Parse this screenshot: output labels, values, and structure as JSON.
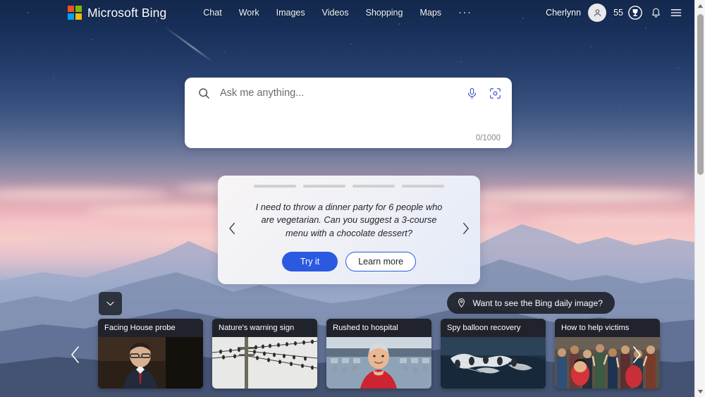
{
  "colors": {
    "ms_red": "#f25022",
    "ms_green": "#7fba00",
    "ms_blue": "#00a4ef",
    "ms_yellow": "#ffb900",
    "accent_blue": "#2b59e0",
    "progress_active": "#2b3a9e",
    "progress_inactive": "#cfcfcf",
    "card_dark": "#20232b",
    "scrollbar_thumb": "#a8a8a8"
  },
  "header": {
    "brand": "Microsoft Bing",
    "logo_icon": "microsoft-logo-icon",
    "nav": [
      {
        "label": "Chat",
        "name": "nav-chat"
      },
      {
        "label": "Work",
        "name": "nav-work"
      },
      {
        "label": "Images",
        "name": "nav-images"
      },
      {
        "label": "Videos",
        "name": "nav-videos"
      },
      {
        "label": "Shopping",
        "name": "nav-shopping"
      },
      {
        "label": "Maps",
        "name": "nav-maps"
      }
    ],
    "more_label": "···",
    "user_name": "Cherlynn",
    "avatar_icon": "person-icon",
    "rewards_count": "55",
    "rewards_icon": "rewards-trophy-icon",
    "notifications_icon": "bell-icon",
    "menu_icon": "hamburger-menu-icon"
  },
  "search": {
    "placeholder": "Ask me anything...",
    "value": "",
    "search_icon": "search-icon",
    "mic_icon": "microphone-icon",
    "camera_icon": "visual-search-camera-icon",
    "char_counter": "0/1000"
  },
  "suggestion": {
    "progress_segments": 4,
    "active_segment": 1,
    "active_fill_percent": 75,
    "prompt": "I need to throw a dinner party for 6 people who are vegetarian. Can you suggest a 3-course menu with a chocolate dessert?",
    "try_label": "Try it",
    "learn_label": "Learn more",
    "prev_icon": "chevron-left-icon",
    "next_icon": "chevron-right-icon"
  },
  "feed": {
    "collapse_icon": "chevron-down-icon",
    "daily_image_tip": "Want to see the Bing daily image?",
    "daily_image_icon": "location-pin-icon",
    "prev_icon": "chevron-left-icon",
    "next_icon": "chevron-right-icon",
    "cards": [
      {
        "title": "Facing House probe",
        "thumb": "politician-hearing-photo"
      },
      {
        "title": "Nature's warning sign",
        "thumb": "birds-on-wires-photo"
      },
      {
        "title": "Rushed to hospital",
        "thumb": "man-red-shirt-stadium-photo"
      },
      {
        "title": "Spy balloon recovery",
        "thumb": "balloon-debris-ocean-photo"
      },
      {
        "title": "How to help victims",
        "thumb": "crowd-aid-photo"
      }
    ]
  },
  "scrollbar": {
    "up_icon": "scroll-up-arrow-icon",
    "down_icon": "scroll-down-arrow-icon",
    "thumb_name": "scrollbar-thumb"
  }
}
